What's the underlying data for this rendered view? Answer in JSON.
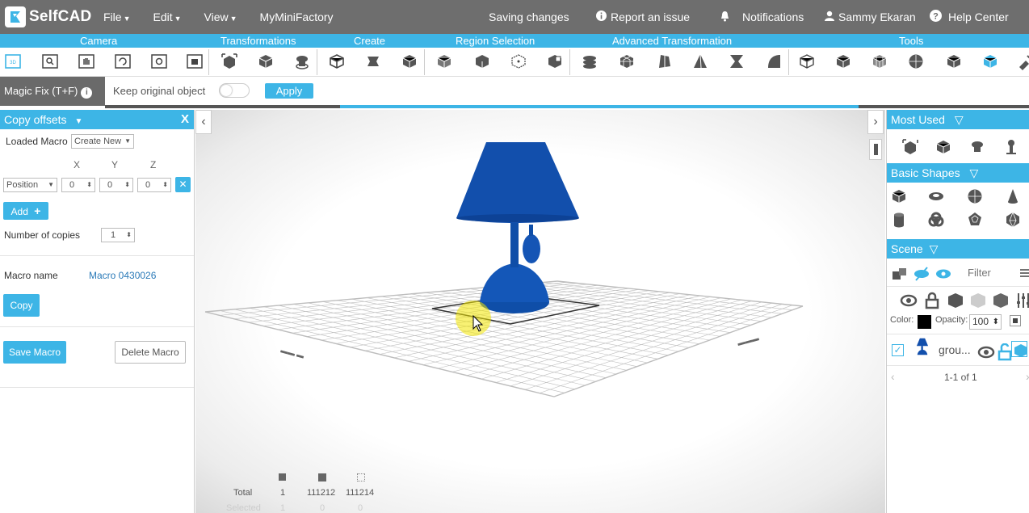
{
  "app": {
    "logo_text": "SelfCAD",
    "menus": [
      {
        "label": "File"
      },
      {
        "label": "Edit"
      },
      {
        "label": "View"
      },
      {
        "label": "MyMiniFactory"
      }
    ],
    "saving_status": "Saving changes",
    "report_issue": "Report an issue",
    "notifications": "Notifications",
    "user_name": "Sammy Ekaran",
    "help_center": "Help Center"
  },
  "categories": {
    "camera": "Camera",
    "transformations": "Transformations",
    "create": "Create",
    "region_selection": "Region Selection",
    "advanced_transformation": "Advanced Transformation",
    "tools": "Tools"
  },
  "magic_fix": {
    "label": "Magic Fix (T+F)",
    "keep_original": "Keep original object",
    "toggle_on": false,
    "apply_label": "Apply"
  },
  "progress_fraction": 0.38,
  "copy_offsets": {
    "title": "Copy offsets",
    "close": "X",
    "loaded_macro_label": "Loaded Macro",
    "loaded_macro_value": "Create New",
    "axis_x": "X",
    "axis_y": "Y",
    "axis_z": "Z",
    "mode_value": "Position",
    "x_value": "0",
    "y_value": "0",
    "z_value": "0",
    "add_label": "Add",
    "copies_label": "Number of copies",
    "copies_value": "1",
    "macro_name_label": "Macro name",
    "macro_name_value": "Macro 0430026",
    "copy_label": "Copy",
    "save_macro_label": "Save Macro",
    "delete_macro_label": "Delete Macro"
  },
  "viewport": {
    "model_color": "#0f4ea8",
    "stats": {
      "total_label": "Total",
      "selected_label": "Selected",
      "total_objects": "1",
      "total_faces": "111212",
      "total_edges": "111214",
      "selected_objects": "1",
      "selected_faces": "0",
      "selected_edges": "0"
    }
  },
  "right_panel": {
    "most_used": "Most Used",
    "basic_shapes": "Basic Shapes",
    "scene": "Scene",
    "filter_placeholder": "Filter",
    "color_label": "Color:",
    "opacity_label": "Opacity:",
    "opacity_value": "100",
    "object_name": "grou...",
    "pagination": "1-1 of 1"
  },
  "colors": {
    "accent": "#3db5e6",
    "topbar": "#6e6e6e"
  }
}
